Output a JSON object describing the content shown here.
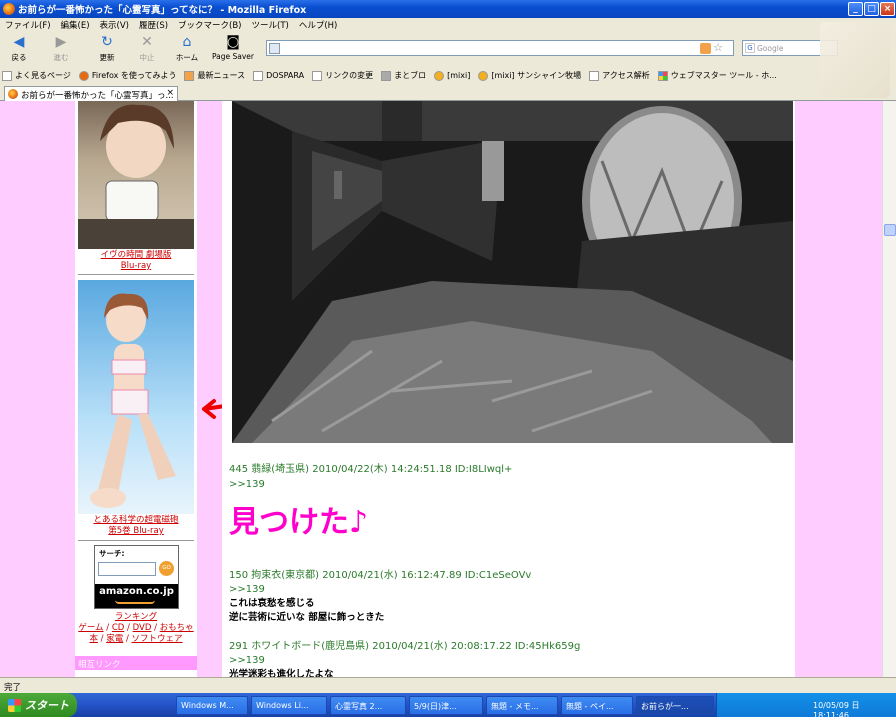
{
  "window": {
    "title": "お前らが一番怖かった「心霊写真」ってなに？ - Mozilla Firefox"
  },
  "menu": [
    "ファイル(F)",
    "編集(E)",
    "表示(V)",
    "履歴(S)",
    "ブックマーク(B)",
    "ツール(T)",
    "ヘルプ(H)"
  ],
  "nav": {
    "back": "戻る",
    "forward": "進む",
    "reload": "更新",
    "stop": "中止",
    "home": "ホーム",
    "page_saver": "Page Saver"
  },
  "search": {
    "placeholder": "Google"
  },
  "bookmarks": [
    "よく見るページ",
    "Firefox を使ってみよう",
    "最新ニュース",
    "DOSPARA",
    "リンクの変更",
    "まとブロ",
    "[mixi]",
    "[mixi] サンシャイン牧場",
    "アクセス解析",
    "ウェブマスター ツール - ホ..."
  ],
  "tab": {
    "label": "お前らが一番怖かった「心霊写真」っ..."
  },
  "sidebar": {
    "ad1": {
      "line1": "イヴの時間 劇場版",
      "line2": "Blu-ray"
    },
    "ad2": {
      "line1": "とある科学の超電磁砲",
      "line2": "第5巻  Blu-ray"
    },
    "amazon": {
      "search_label": "サーチ:",
      "go": "GO",
      "logo": "amazon.co.jp"
    },
    "links": {
      "ranking": "ランキング",
      "row1": [
        "ゲーム",
        "CD",
        "DVD",
        "おもちゃ"
      ],
      "row2": [
        "本",
        "家電",
        "ソフトウェア"
      ]
    },
    "section": "相互リンク"
  },
  "annotation": {
    "text": "ココ"
  },
  "posts": [
    {
      "header": "445 翡緑(埼玉県) 2010/04/22(木) 14:24:51.18 ID:I8LIwql+",
      "anchor": ">>139",
      "body": "見つけた♪"
    },
    {
      "header": "150 拘束衣(東京都) 2010/04/21(水) 16:12:47.89 ID:C1eSeOVv",
      "anchor": ">>139",
      "body": [
        "これは哀愁を感じる",
        "逆に芸術に近いな  部屋に飾っときた"
      ]
    },
    {
      "header": "291 ホワイトボード(鹿児島県) 2010/04/21(水) 20:08:17.22 ID:45Hk659g",
      "anchor": ">>139",
      "body": [
        "光学迷彩も進化したよな"
      ]
    }
  ],
  "status": {
    "text": "完了"
  },
  "taskbar": {
    "start": "スタート",
    "items": [
      "Windows M...",
      "Windows Li...",
      "心霊写真 2...",
      "5/9(日)津...",
      "無題 - メモ...",
      "無題 - ペイ...",
      "お前らが一..."
    ],
    "clock": "10/05/09 日 18:11:46"
  },
  "colors": {
    "page_bg": "#ffccff",
    "link": "#cc0000",
    "post_head": "#2a7a2a",
    "title_highlight": "#ff00cc",
    "annotation": "#ee0000"
  }
}
